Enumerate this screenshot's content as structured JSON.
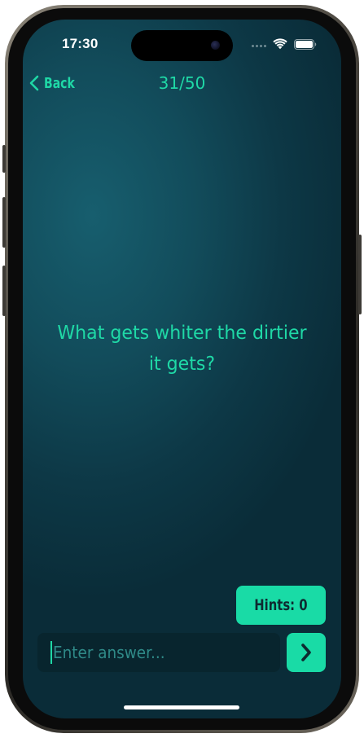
{
  "status_bar": {
    "time": "17:30"
  },
  "nav": {
    "back_label": "Back",
    "progress": "31/50"
  },
  "question": {
    "text": "What gets whiter the dirtier it gets?"
  },
  "hints": {
    "label": "Hints: 0"
  },
  "answer": {
    "placeholder": "Enter answer..."
  },
  "icons": {
    "back": "chevron-left-icon",
    "submit": "chevron-right-icon",
    "wifi": "wifi-icon",
    "battery": "battery-icon"
  },
  "colors": {
    "accent": "#1fd8a6",
    "button_fill": "#19dba6",
    "button_text": "#0e2a30",
    "background_light": "#175e6e",
    "background_dark": "#0a2c38"
  }
}
